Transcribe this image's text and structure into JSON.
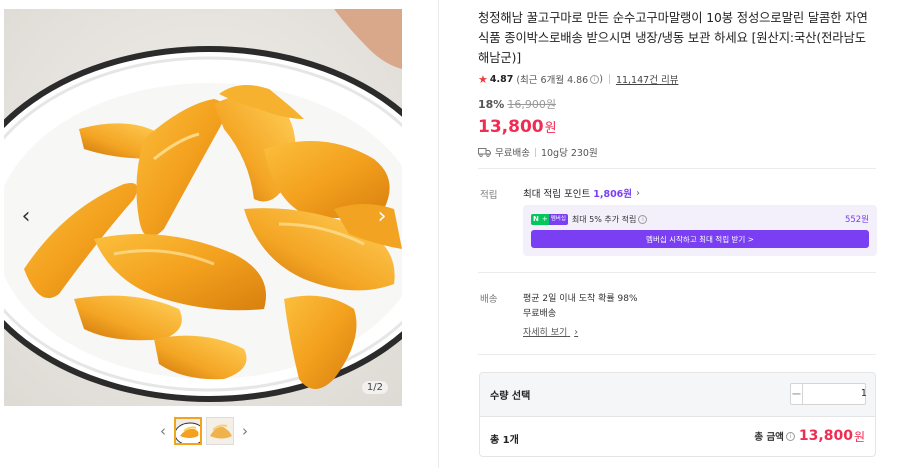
{
  "gallery": {
    "page_indicator": "1/2",
    "prev_icon": "chevron-left-icon",
    "next_icon": "chevron-right-icon",
    "thumbnail_count": 2,
    "active_thumbnail": 1
  },
  "product": {
    "title": "청정해남 꿀고구마로 만든 순수고구마말랭이 10봉 정성으로말린 달콤한 자연식품 종이박스로배송 받으시면 냉장/냉동 보관 하세요 [원산지:국산(전라남도 해남군)]",
    "rating": "4.87",
    "rating_recent": "(최근 6개월 4.86",
    "rating_recent_close": ")",
    "review_count": "11,147건 리뷰",
    "discount_rate": "18%",
    "original_price": "16,900원",
    "price": "13,800",
    "price_unit": "원",
    "shipping": "무료배송",
    "unit_price": "10g당 230원"
  },
  "points": {
    "label": "적립",
    "title": "최대 적립 포인트",
    "amount": "1,806원",
    "membership_badge_n": "N",
    "membership_badge_plus": "+",
    "membership_badge_text": "멤버십",
    "membership_extra": "최대 5% 추가 적립",
    "membership_amount": "552원",
    "membership_button": "멤버십 시작하고 최대 적립 받기 >"
  },
  "delivery": {
    "label": "배송",
    "line1": "평균 2일 이내 도착 확률 98%",
    "line2": "무료배송",
    "detail_link": "자세히 보기"
  },
  "quantity": {
    "label": "수량 선택",
    "value": "1",
    "minus": "−",
    "plus": "+",
    "total_count": "총 1개",
    "total_label": "총 금액",
    "total_price": "13,800",
    "total_unit": "원"
  },
  "colors": {
    "accent_price": "#f02c53",
    "membership_purple": "#7a3ff2",
    "naver_green": "#03c75a"
  }
}
